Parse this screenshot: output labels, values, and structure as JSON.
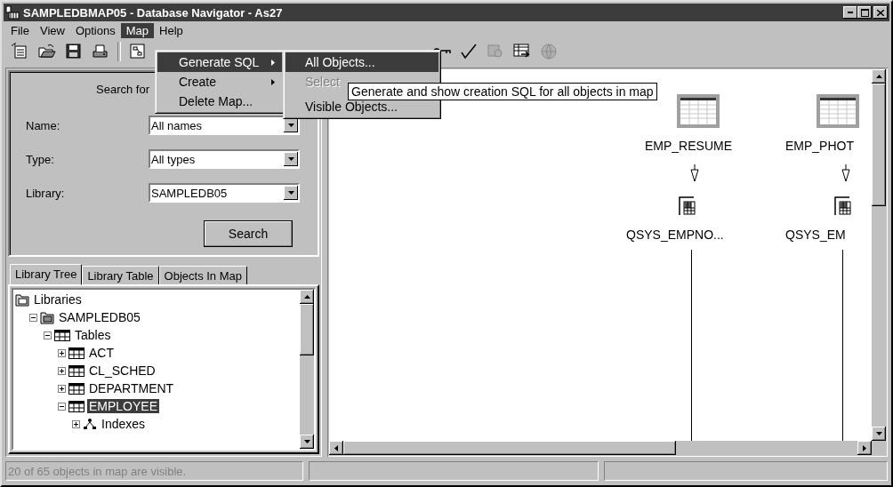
{
  "window": {
    "title": "SAMPLEDBMAP05 - Database Navigator - As27"
  },
  "menu_bar": [
    {
      "label": "File",
      "selected": false
    },
    {
      "label": "View",
      "selected": false
    },
    {
      "label": "Options",
      "selected": false
    },
    {
      "label": "Map",
      "selected": true
    },
    {
      "label": "Help",
      "selected": false
    }
  ],
  "toolbar_left": [
    {
      "disabled": false
    },
    {
      "disabled": false
    },
    {
      "disabled": false
    },
    {
      "disabled": false
    },
    {
      "disabled": false
    }
  ],
  "toolbar_right": [
    {
      "disabled": false
    },
    {
      "disabled": false
    },
    {
      "disabled": true
    },
    {
      "disabled": false
    },
    {
      "disabled": true
    }
  ],
  "open_menu": {
    "items": [
      {
        "label": "Generate SQL",
        "submenu": true,
        "selected": true
      },
      {
        "label": "Create",
        "submenu": true,
        "selected": false
      },
      {
        "label": "Delete Map...",
        "submenu": false,
        "selected": false
      }
    ]
  },
  "submenu": {
    "items": [
      {
        "label": "All Objects...",
        "selected": true,
        "disabled": false
      },
      {
        "label": "Select",
        "selected": false,
        "disabled": true
      },
      {
        "label": "Visible Objects...",
        "selected": false,
        "disabled": false
      }
    ]
  },
  "tooltip": "Generate and show creation SQL for all objects in map",
  "search_panel": {
    "heading": "Search for",
    "fields": [
      {
        "label": "Name:",
        "value": "All names"
      },
      {
        "label": "Type:",
        "value": "All types"
      },
      {
        "label": "Library:",
        "value": "SAMPLEDB05"
      }
    ],
    "button": "Search"
  },
  "tabs": [
    {
      "label": "Library Tree",
      "selected": true
    },
    {
      "label": "Library Table",
      "selected": false
    },
    {
      "label": "Objects In Map",
      "selected": false
    }
  ],
  "tree": [
    {
      "label": "Libraries",
      "kind": "root",
      "selected": false,
      "children": [
        {
          "label": "SAMPLEDB05",
          "kind": "library",
          "expanded": true,
          "selected": false,
          "children": [
            {
              "label": "Tables",
              "kind": "table",
              "expanded": true,
              "selected": false,
              "children": [
                {
                  "label": "ACT",
                  "kind": "table",
                  "expanded": false,
                  "selected": false
                },
                {
                  "label": "CL_SCHED",
                  "kind": "table",
                  "expanded": false,
                  "selected": false
                },
                {
                  "label": "DEPARTMENT",
                  "kind": "table",
                  "expanded": false,
                  "selected": false
                },
                {
                  "label": "EMPLOYEE",
                  "kind": "table",
                  "expanded": true,
                  "selected": true,
                  "children": [
                    {
                      "label": "Indexes",
                      "kind": "index",
                      "expanded": false,
                      "selected": false
                    }
                  ]
                }
              ]
            }
          ]
        }
      ]
    }
  ],
  "map_nodes": [
    {
      "table": "EMP_RESUME",
      "index": "QSYS_EMPNO..."
    },
    {
      "table": "EMP_PHOT",
      "index": "QSYS_EM"
    }
  ],
  "status_bar": {
    "message": "20 of 65 objects in map are visible."
  }
}
